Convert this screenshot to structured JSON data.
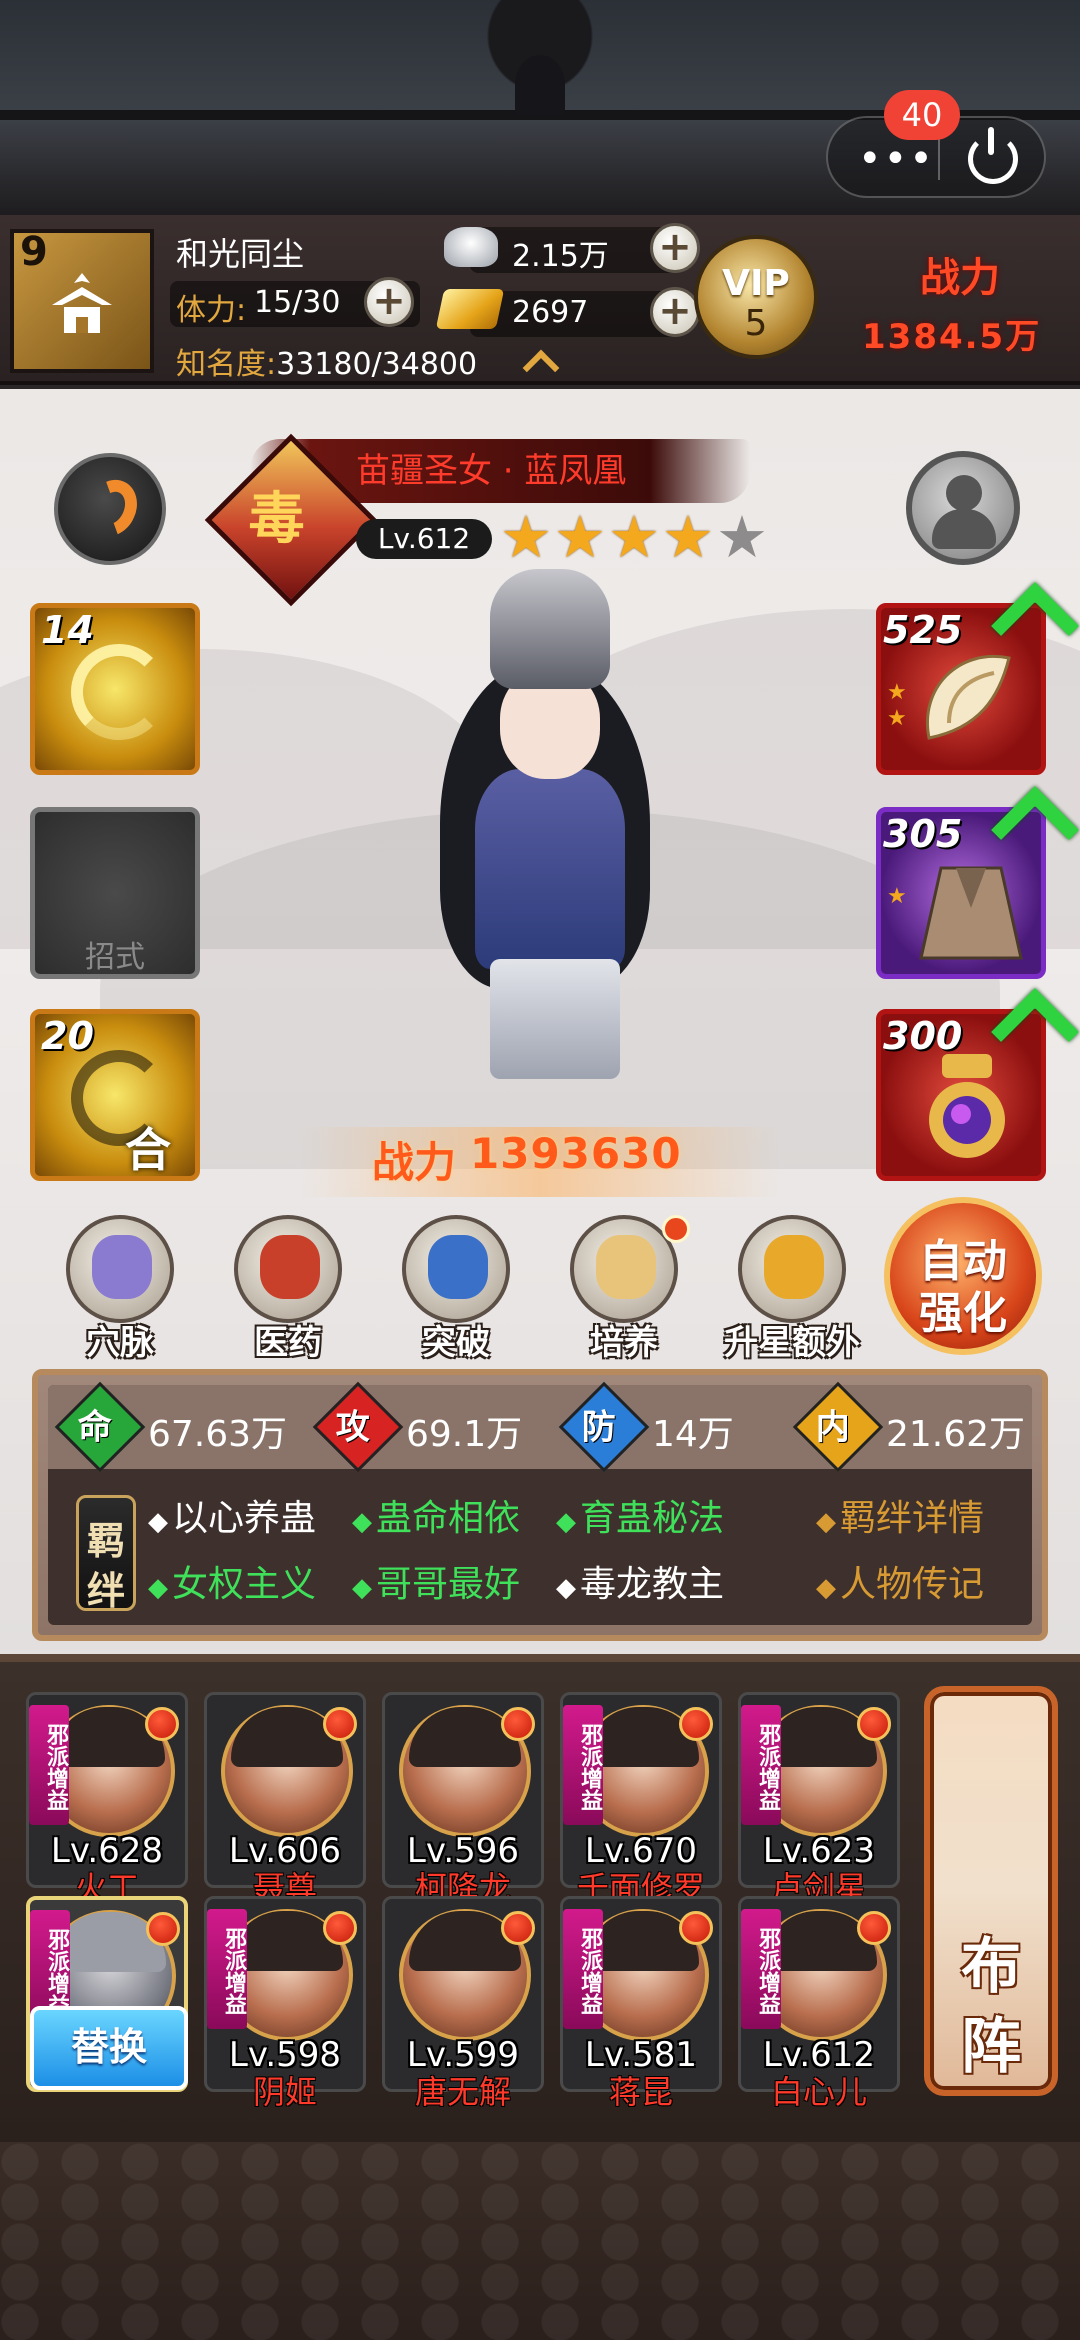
{
  "system": {
    "notification_count": "40",
    "more_icon": "more-dots-icon",
    "exit_icon": "power-icon"
  },
  "player": {
    "level": "9",
    "name": "和光同尘",
    "stamina_label": "体力:",
    "stamina_value": "15/30",
    "fame_label": "知名度:",
    "fame_value": "33180/34800",
    "silver": "2.15万",
    "gold": "2697",
    "vip_label": "VIP",
    "vip_level": "5",
    "power_label": "战力",
    "power_value": "1384.5万"
  },
  "hero": {
    "title": "苗疆圣女 · 蓝凤凰",
    "faction_glyph": "毒",
    "level": "Lv.612",
    "stars_total": 5,
    "stars_filled": 4,
    "power_label": "战力",
    "power_value": "1393630"
  },
  "skills": [
    {
      "count": "14",
      "icon": "whirlwind-skill-icon"
    },
    {
      "label": "招式",
      "icon": "empty-skill-slot"
    },
    {
      "count": "20",
      "combo": "合",
      "icon": "combo-skill-icon"
    }
  ],
  "equipment": [
    {
      "count": "525",
      "stars": 2,
      "icon": "conch-weapon-icon",
      "upgradeable": true
    },
    {
      "count": "305",
      "stars": 1,
      "icon": "cloak-armor-icon",
      "upgradeable": true
    },
    {
      "count": "300",
      "stars": 0,
      "icon": "orb-treasure-icon",
      "upgradeable": true
    }
  ],
  "functions": [
    {
      "label": "穴脉",
      "icon": "meridian-icon",
      "has_dot": false
    },
    {
      "label": "医药",
      "icon": "medicine-icon",
      "has_dot": false
    },
    {
      "label": "突破",
      "icon": "breakthrough-icon",
      "has_dot": false
    },
    {
      "label": "培养",
      "icon": "training-scroll-icon",
      "has_dot": true
    },
    {
      "label": "升星额外",
      "icon": "star-up-icon",
      "has_dot": false
    }
  ],
  "auto_enhance": {
    "line1": "自动",
    "line2": "强化"
  },
  "stats": [
    {
      "glyph": "命",
      "value": "67.63万",
      "color": "#27a63a"
    },
    {
      "glyph": "攻",
      "value": "69.1万",
      "color": "#d82323"
    },
    {
      "glyph": "防",
      "value": "14万",
      "color": "#2a7ed8"
    },
    {
      "glyph": "内",
      "value": "21.62万",
      "color": "#e6a41a"
    }
  ],
  "bonds": {
    "seal_top": "羁",
    "seal_bottom": "绊",
    "row1": [
      {
        "text": "以心养蛊",
        "active": false
      },
      {
        "text": "蛊命相依",
        "active": true
      },
      {
        "text": "育蛊秘法",
        "active": true
      }
    ],
    "row2": [
      {
        "text": "女权主义",
        "active": true
      },
      {
        "text": "哥哥最好",
        "active": true
      },
      {
        "text": "毒龙教主",
        "active": false
      }
    ],
    "details_link": "羁绊详情",
    "biography_link": "人物传记"
  },
  "lineup": {
    "tag_text": "邪派增益",
    "swap_label": "替换",
    "formation_line1": "布",
    "formation_line2": "阵",
    "heroes": [
      {
        "level": "Lv.628",
        "name": "火工",
        "tag": true
      },
      {
        "level": "Lv.606",
        "name": "聂尊",
        "tag": false
      },
      {
        "level": "Lv.596",
        "name": "柯降龙",
        "tag": false
      },
      {
        "level": "Lv.670",
        "name": "千面修罗",
        "tag": true
      },
      {
        "level": "Lv.623",
        "name": "卢剑星",
        "tag": true
      },
      {
        "level": "",
        "name": "",
        "tag": true,
        "selected": true
      },
      {
        "level": "Lv.598",
        "name": "阴姬",
        "tag": true
      },
      {
        "level": "Lv.599",
        "name": "唐无解",
        "tag": false
      },
      {
        "level": "Lv.581",
        "name": "蒋昆",
        "tag": true
      },
      {
        "level": "Lv.612",
        "name": "白心儿",
        "tag": true
      }
    ]
  }
}
